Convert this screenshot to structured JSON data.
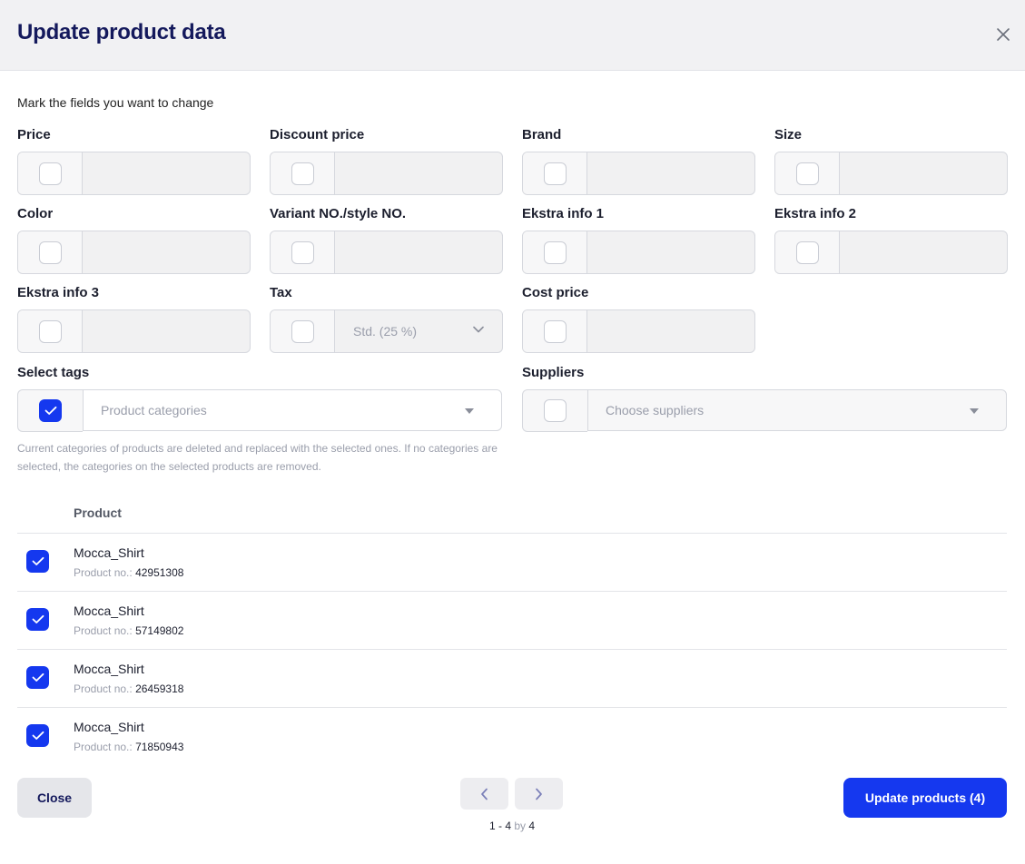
{
  "header": {
    "title": "Update product data"
  },
  "intro": "Mark the fields you want to change",
  "fields": [
    {
      "label": "Price"
    },
    {
      "label": "Discount price"
    },
    {
      "label": "Brand"
    },
    {
      "label": "Size"
    },
    {
      "label": "Color"
    },
    {
      "label": "Variant NO./style NO."
    },
    {
      "label": "Ekstra info 1"
    },
    {
      "label": "Ekstra info 2"
    },
    {
      "label": "Ekstra info 3"
    },
    {
      "label": "Tax",
      "value": "Std. (25 %)"
    },
    {
      "label": "Cost price"
    }
  ],
  "tags": {
    "label": "Select tags",
    "placeholder": "Product categories",
    "checked": true
  },
  "suppliers": {
    "label": "Suppliers",
    "placeholder": "Choose suppliers",
    "checked": false
  },
  "help_text": "Current categories of products are deleted and replaced with the selected ones. If no categories are selected, the categories on the selected products are removed.",
  "table": {
    "header": "Product",
    "product_no_label": "Product no.:",
    "rows": [
      {
        "name": "Mocca_Shirt",
        "number": "42951308",
        "checked": true
      },
      {
        "name": "Mocca_Shirt",
        "number": "57149802",
        "checked": true
      },
      {
        "name": "Mocca_Shirt",
        "number": "26459318",
        "checked": true
      },
      {
        "name": "Mocca_Shirt",
        "number": "71850943",
        "checked": true
      }
    ]
  },
  "footer": {
    "close_label": "Close",
    "update_label": "Update products (4)",
    "pagination": {
      "range": "1 - 4",
      "by": "by",
      "total": "4"
    }
  },
  "colors": {
    "accent": "#1538ef",
    "title": "#14195c",
    "header_bg": "#f1f1f3"
  }
}
